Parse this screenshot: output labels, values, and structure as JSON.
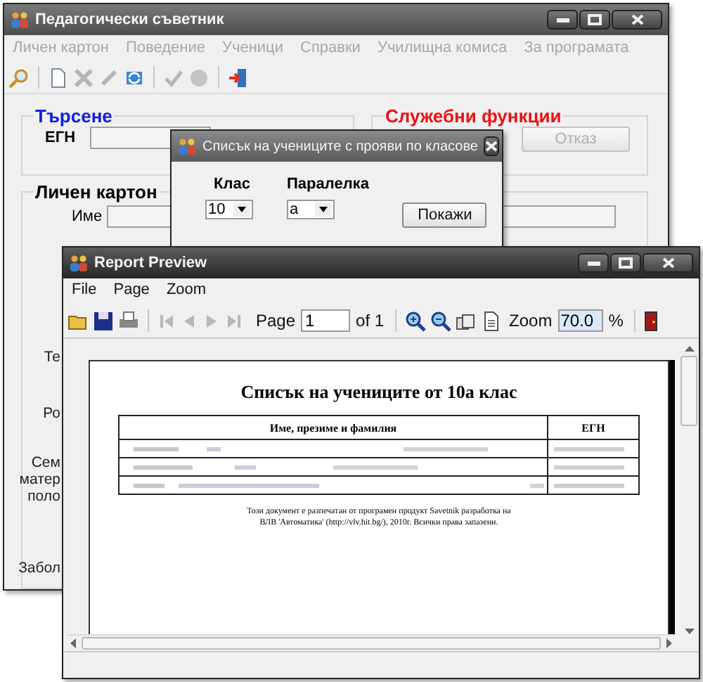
{
  "main_window": {
    "title": "Педагогически съветник",
    "menu": [
      {
        "label": "Личен картон",
        "disabled": true
      },
      {
        "label": "Поведение",
        "disabled": true
      },
      {
        "label": "Ученици",
        "disabled": true
      },
      {
        "label": "Справки",
        "disabled": true
      },
      {
        "label": "Училищна комиса",
        "disabled": true
      },
      {
        "label": "За програмата",
        "disabled": true
      }
    ],
    "toolbar": [
      [
        {
          "kind": "search",
          "disabled": false
        }
      ],
      [
        {
          "kind": "new",
          "disabled": false
        },
        {
          "kind": "delete",
          "disabled": true
        },
        {
          "kind": "edit",
          "disabled": true
        },
        {
          "kind": "refresh",
          "disabled": false
        }
      ],
      [
        {
          "kind": "confirm",
          "disabled": true
        },
        {
          "kind": "cancel",
          "disabled": true
        }
      ],
      [
        {
          "kind": "exit",
          "disabled": false
        }
      ]
    ],
    "search_group": {
      "title": "Търсене",
      "label": "ЕГН"
    },
    "service_group": {
      "title": "Служебни функции",
      "cancel_button": {
        "label": "Отказ",
        "disabled": true
      }
    },
    "card_group": {
      "title": "Личен картон",
      "name_label": "Име",
      "cut_labels": [
        [
          "Те"
        ],
        [
          "Ро"
        ],
        [
          "Сем",
          "матер",
          "поло"
        ],
        [
          "Забол"
        ]
      ]
    }
  },
  "dialog": {
    "title": "Списък на учениците с прояви по класове",
    "fields": [
      {
        "label": "Клас",
        "value": "10"
      },
      {
        "label": "Паралелка",
        "value": "а"
      }
    ],
    "button": "Покажи"
  },
  "report_window": {
    "title": "Report Preview",
    "menu": [
      "File",
      "Page",
      "Zoom"
    ],
    "toolbar": {
      "file": [
        {
          "kind": "open"
        },
        {
          "kind": "save"
        },
        {
          "kind": "print"
        }
      ],
      "nav": [
        {
          "kind": "first",
          "disabled": true
        },
        {
          "kind": "prev",
          "disabled": true
        },
        {
          "kind": "next",
          "disabled": true
        },
        {
          "kind": "last",
          "disabled": true
        }
      ],
      "page_label": "Page",
      "page_value": "1",
      "page_of": "of 1",
      "views": [
        {
          "kind": "zoom-in"
        },
        {
          "kind": "zoom-out"
        },
        {
          "kind": "pages"
        },
        {
          "kind": "page"
        }
      ],
      "zoom_label": "Zoom",
      "zoom_value": "70.0",
      "zoom_unit": "%"
    },
    "report": {
      "title": "Списък на учениците от 10а клас",
      "columns": [
        "Име, презиме и фамилия",
        "ЕГН"
      ],
      "footer": [
        "Този документ е разпечатан от програмен продукт Savetnik разработка на",
        "ВЛВ 'Автоматика' (http://vlv.hit.bg/), 2010г. Всички права запазени."
      ]
    }
  }
}
